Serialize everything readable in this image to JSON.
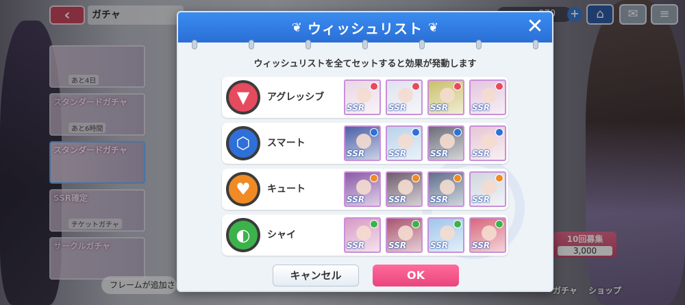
{
  "header": {
    "screen_title": "ガチャ",
    "resource_value": "870"
  },
  "banners": [
    {
      "title": "",
      "sub": "あと4日"
    },
    {
      "title": "スタンダードガチャ",
      "sub": "あと6時間"
    },
    {
      "title": "スタンダードガチャ",
      "sub": ""
    },
    {
      "title": "SSR確定",
      "sub": "チケットガチャ"
    },
    {
      "title": "サークルガチャ",
      "sub": ""
    }
  ],
  "bottom": {
    "pull_label": "10回募集",
    "pull_cost": "3,000",
    "gacha_label": "ガチャ",
    "shop_label": "ショップ",
    "toast": "フレームが追加さ"
  },
  "modal": {
    "title": "ウィッシュリスト",
    "instruction": "ウィッシュリストを全てセットすると効果が発動します",
    "rows": [
      {
        "label": "アグレッシブ",
        "color": "#e64a5e",
        "icon": "aggressive-icon",
        "card_colors": [
          "#e8d7e4",
          "#dfe2ef",
          "#c9c06a",
          "#e3c6df"
        ],
        "mark_color": "#e64a5e"
      },
      {
        "label": "スマート",
        "color": "#2f6fd8",
        "icon": "smart-icon",
        "card_colors": [
          "#4b5fa6",
          "#b9d2ea",
          "#6b6c78",
          "#e6c7d5"
        ],
        "mark_color": "#2f6fd8"
      },
      {
        "label": "キュート",
        "color": "#ef8a24",
        "icon": "cute-icon",
        "card_colors": [
          "#8a5aa8",
          "#6e5d6c",
          "#5f6f8b",
          "#cfd6e0"
        ],
        "mark_color": "#ef8a24"
      },
      {
        "label": "シャイ",
        "color": "#3cb24a",
        "icon": "shy-icon",
        "card_colors": [
          "#d79ac4",
          "#a8556e",
          "#9ec6ea",
          "#d8677c"
        ],
        "mark_color": "#3cb24a"
      }
    ],
    "card_badge": "SSR",
    "cancel_label": "キャンセル",
    "ok_label": "OK"
  }
}
